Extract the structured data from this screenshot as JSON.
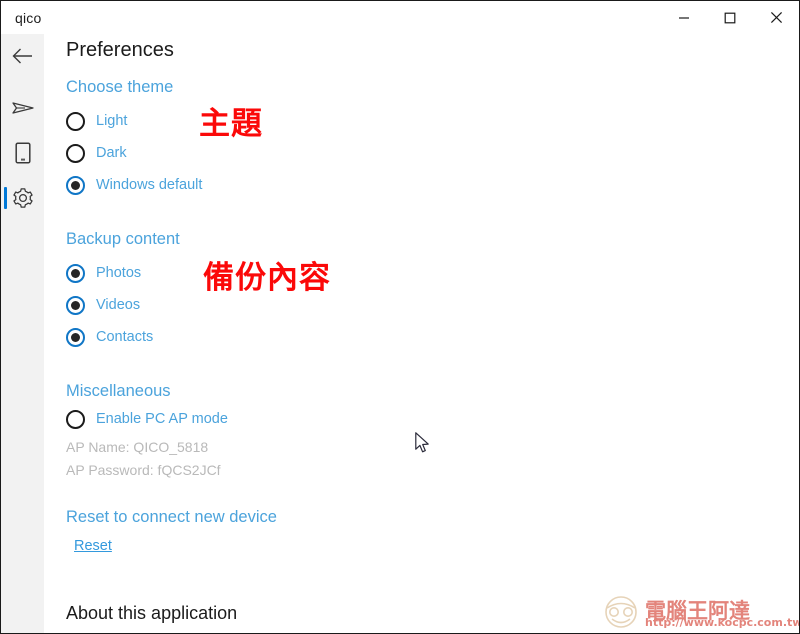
{
  "window": {
    "logo": "qico",
    "controls": [
      {
        "name": "minimize-button",
        "glyph": "minimize"
      },
      {
        "name": "maximize-button",
        "glyph": "maximize"
      },
      {
        "name": "close-button",
        "glyph": "close"
      }
    ]
  },
  "sidebar": {
    "items": [
      {
        "name": "sidebar-item-back",
        "icon": "back-arrow-icon",
        "selected": false
      },
      {
        "name": "sidebar-item-send",
        "icon": "send-icon",
        "selected": false
      },
      {
        "name": "sidebar-item-device",
        "icon": "phone-icon",
        "selected": false
      },
      {
        "name": "sidebar-item-settings",
        "icon": "gear-icon",
        "selected": true
      }
    ]
  },
  "main": {
    "page_title": "Preferences",
    "theme": {
      "heading": "Choose theme",
      "annotation": "主題",
      "options": [
        {
          "label": "Light",
          "selected": false
        },
        {
          "label": "Dark",
          "selected": false
        },
        {
          "label": "Windows default",
          "selected": true
        }
      ]
    },
    "backup": {
      "heading": "Backup content",
      "annotation": "備份內容",
      "options": [
        {
          "label": "Photos",
          "selected": true
        },
        {
          "label": "Videos",
          "selected": true
        },
        {
          "label": "Contacts",
          "selected": true
        }
      ]
    },
    "misc": {
      "heading": "Miscellaneous",
      "ap_mode": {
        "label": "Enable PC AP mode",
        "selected": false
      },
      "ap_name_label": "AP Name:",
      "ap_name_value": "QICO_5818",
      "ap_password_label": "AP Password:",
      "ap_password_value": "fQCS2JCf",
      "ap_name_line": "AP Name:  QICO_5818",
      "ap_password_line": "AP Password:  fQCS2JCf"
    },
    "reset": {
      "heading": "Reset to connect new device",
      "link": "Reset"
    },
    "about": {
      "heading": "About this application"
    }
  },
  "watermark": {
    "text": "電腦王阿達",
    "url": "http://www.kocpc.com.tw"
  },
  "colors": {
    "accent_blue": "#0078d7",
    "link_blue": "#4ba3dc",
    "annotation_red": "#fb0909",
    "sidebar_bg": "#f2f2f2",
    "muted_gray": "#b9b9b9"
  }
}
